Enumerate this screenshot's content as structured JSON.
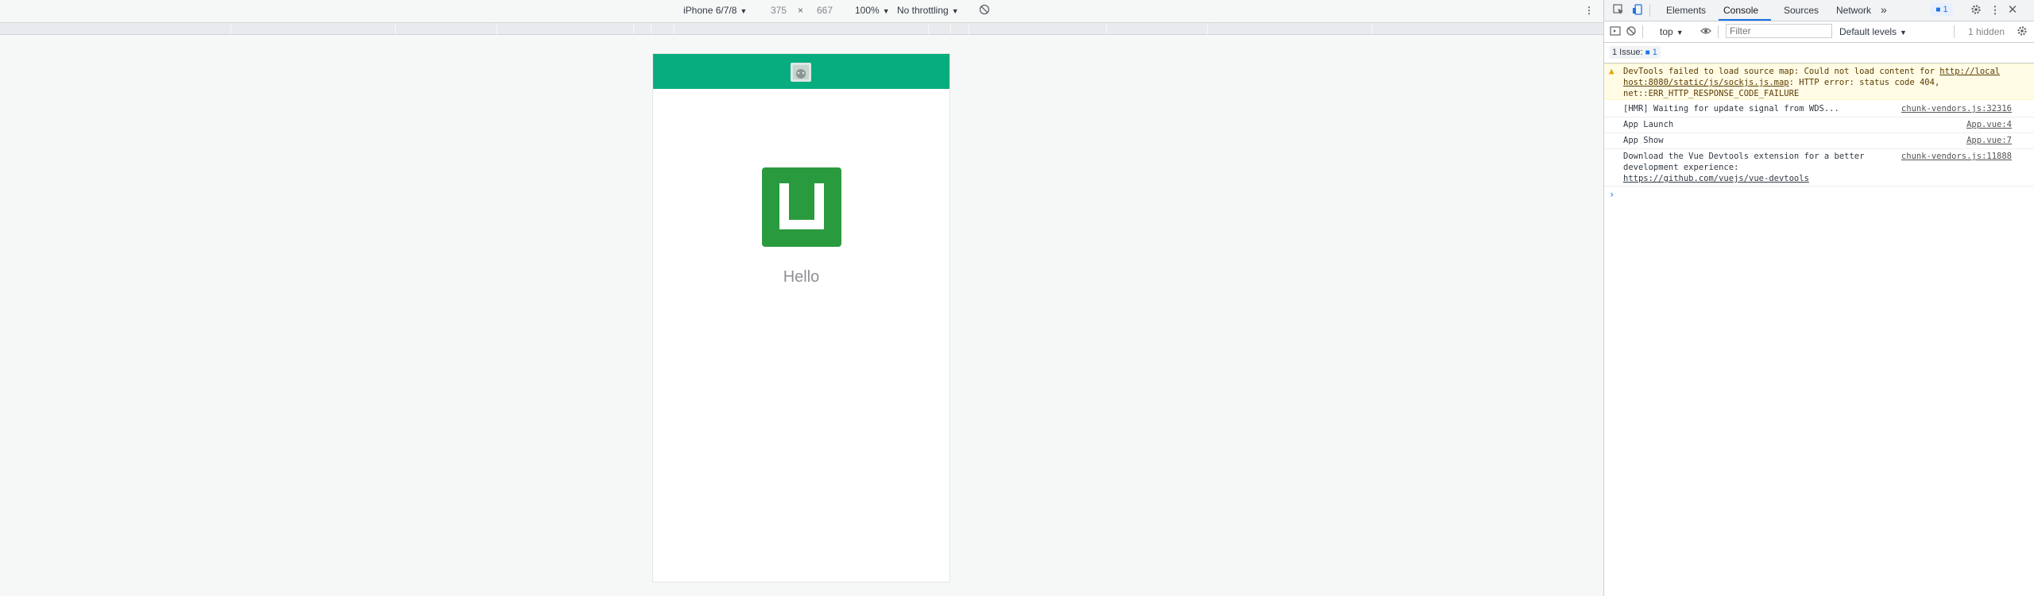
{
  "device_toolbar": {
    "device": "iPhone 6/7/8",
    "width": "375",
    "times": "×",
    "height": "667",
    "zoom": "100%",
    "throttling": "No throttling",
    "caret": "▼",
    "rotate_icon": "rotate-icon",
    "more_icon": "⋮"
  },
  "app": {
    "nav_color": "#07ad7f",
    "logo_color": "#2a9a3e",
    "hello_text": "Hello"
  },
  "devtools": {
    "tabs": [
      "Elements",
      "Console",
      "Sources",
      "Network"
    ],
    "more_tabs": "»",
    "issue_badge": "1",
    "console_toolbar": {
      "context": "top",
      "filter_placeholder": "Filter",
      "levels": "Default levels",
      "hidden": "1 hidden"
    },
    "issues_bar": "1 Issue:",
    "issues_count": "1",
    "messages": [
      {
        "line1": "DevTools failed to load source map: Could not load content for ",
        "link1": "http://local",
        "link2": "host:8080/static/js/sockjs.js.map",
        "line2": ": HTTP error: status code 404,",
        "line3": "net::ERR_HTTP_RESPONSE_CODE_FAILURE"
      },
      {
        "text": "[HMR] Waiting for update signal from WDS...",
        "source": "chunk-vendors.js:32316"
      },
      {
        "text": "App Launch",
        "source": "App.vue:4"
      },
      {
        "text": "App Show",
        "source": "App.vue:7"
      },
      {
        "text": "Download the Vue Devtools extension for a better development experience:",
        "link": "https://github.com/vuejs/vue-devtools",
        "source": "chunk-vendors.js:11888"
      }
    ],
    "prompt": "›"
  }
}
